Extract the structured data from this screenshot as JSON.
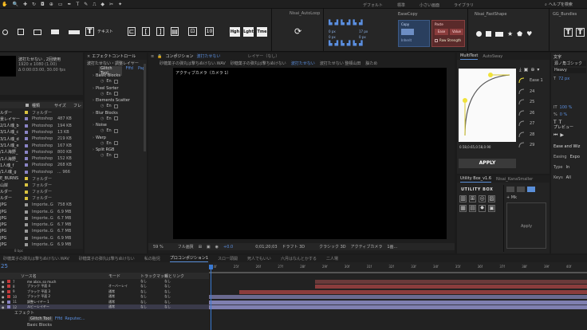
{
  "menubar": {
    "workspaces": [
      "デフォルト",
      "標準",
      "小さい画面",
      "ライブラリ"
    ],
    "search_label": "ヘルプを検索"
  },
  "toolbar": {
    "text_label": "テキスト",
    "panels": [
      "Nisai_AutoLoop",
      "EaseCopy",
      "Nisai_FastShape",
      "GG_Bundles"
    ],
    "ease_copy": {
      "copy": "Copy",
      "paste": "Paste",
      "ease": "Ease",
      "value": "Value",
      "raw_strength": "Raw Strength",
      "inherit": "Inherit"
    },
    "ease_values": [
      "0 px",
      "0 px",
      "17 px",
      "0 px"
    ]
  },
  "project_panel": {
    "comp_name": "波打たせない , 2回使用",
    "comp_info1": "1920 x 1080 (1.00)",
    "comp_info2": "Δ 0:00:03:00, 30.00 fps",
    "headers": {
      "name": "種類",
      "size": "サイズ",
      "frame": "フレ"
    },
    "items": [
      {
        "name": "ルダー",
        "type": "フォルダー",
        "size": "",
        "color": "#d9c33f"
      },
      {
        "name": "景レイヤー",
        "type": "Photoshop",
        "size": "487 KB",
        "color": "#8a84c6"
      },
      {
        "name": "2/1人魂_b",
        "type": "Photoshop",
        "size": "194 KB",
        "color": "#8a84c6"
      },
      {
        "name": "3/1人魂_c",
        "type": "Photoshop",
        "size": "13 KB",
        "color": "#8a84c6"
      },
      {
        "name": "3/1人魂_d",
        "type": "Photoshop",
        "size": "219 KB",
        "color": "#8a84c6"
      },
      {
        "name": "3/1人魂_e",
        "type": "Photoshop",
        "size": "167 KB",
        "color": "#8a84c6"
      },
      {
        "name": "/1人海野_",
        "type": "Photoshop",
        "size": "800 KB",
        "color": "#8a84c6"
      },
      {
        "name": "/1人海野_",
        "type": "Photoshop",
        "size": "152 KB",
        "color": "#8a84c6"
      },
      {
        "name": "1人魂_f",
        "type": "Photoshop",
        "size": "268 KB",
        "color": "#8a84c6"
      },
      {
        "name": "/1人魂_g",
        "type": "Photoshop",
        "size": "... 966",
        "color": "#8a84c6"
      },
      {
        "name": "E_BURNS",
        "type": "フォルダー",
        "size": "",
        "color": "#d9c33f"
      },
      {
        "name": "山岸",
        "type": "フォルダー",
        "size": "",
        "color": "#d9c33f"
      },
      {
        "name": "ルダー",
        "type": "フォルダー",
        "size": "",
        "color": "#d9c33f"
      },
      {
        "name": "ルダー",
        "type": "フォルダー",
        "size": "",
        "color": "#d9c33f"
      },
      {
        "name": "JPG",
        "type": "Importe..G",
        "size": "758 KB",
        "color": "#9a9a9a"
      },
      {
        "name": "JPG",
        "type": "Importe..G",
        "size": "6.9 MB",
        "color": "#9a9a9a"
      },
      {
        "name": "JPG",
        "type": "Importe..G",
        "size": "6.7 MB",
        "color": "#9a9a9a"
      },
      {
        "name": "JPG",
        "type": "Importe..G",
        "size": "6.7 MB",
        "color": "#9a9a9a"
      },
      {
        "name": "JPG",
        "type": "Importe..G",
        "size": "6.7 MB",
        "color": "#9a9a9a"
      },
      {
        "name": "JPG",
        "type": "Importe..G",
        "size": "6.9 MB",
        "color": "#9a9a9a"
      },
      {
        "name": "JPG",
        "type": "Importe..G",
        "size": "6.9 MB",
        "color": "#9a9a9a"
      }
    ],
    "footer": "8 bpc"
  },
  "effect_controls": {
    "title": "エフェクトコントロール",
    "subtitle": "波打たせない・調整レイヤー",
    "tabs": [
      "Glitch Tool",
      "Fffd",
      "Pap"
    ],
    "effects": [
      "Basic Blocks",
      "Pixel Sorter",
      "Elements Scatter",
      "Blur Blocks",
      "Noise",
      "Warp",
      "Split RGB"
    ],
    "en_label": "En"
  },
  "composition": {
    "panel_title": "コンポジション",
    "comp_tab": "波打たせない",
    "layer_tab": "レイヤー（なし）",
    "breadcrumbs": [
      "砂糖菓子の弾丸は撃ちぬけない.WAV",
      "砂糖菓子の弾丸は撃ちぬけない",
      "波打たせない",
      "波打たせない 整頓山田",
      "脳ため"
    ],
    "viewer_label": "アクティブカメラ（カメラ 1）",
    "footer": {
      "zoom": "59 %",
      "quality": "フル画質",
      "timecode": "0;01;20;03",
      "exposure": "+0.0",
      "view": "ドラフト 3D",
      "renderer": "クラシック 3D",
      "camera": "アクティブカメラ",
      "views": "1画..."
    }
  },
  "multitext": {
    "tabs": [
      "MultiText",
      "AutoSway"
    ],
    "curve_values": "0.58,0.65,0.58,0.90",
    "apply_label": "APPLY",
    "presets": [
      "Ease 1",
      "24",
      "25",
      "26",
      "27",
      "28",
      "29"
    ]
  },
  "utility_box": {
    "tabs": [
      "Utility Box_v1.6",
      "Nisai_KanaSmaller"
    ],
    "logo": "UTILITY BOX",
    "apply_label": "Apply",
    "mode_label": "Mk"
  },
  "character_panel": {
    "title": "文字",
    "font_family": "源ノ角ゴシック",
    "font_style": "Heavy",
    "size": "72 px",
    "tracking": "100 %",
    "scale": "0 %",
    "preview_title": "プレビュー",
    "ease_title": "Ease and Wiz",
    "ease_rows": [
      "Easing",
      "Type",
      "Keys"
    ],
    "ease_values": [
      "Expo",
      "In",
      "All"
    ]
  },
  "timeline": {
    "tabs": [
      "砂糖菓子の弾丸は撃ちぬけない.WAV",
      "砂糖菓子の弾丸は撃ちぬけない",
      "私の胎児",
      "プロコンポジション1",
      "スロー頭開",
      "死人でもいい",
      "六月はなんとかする",
      "二人場"
    ],
    "timecode": "25",
    "headers": {
      "source": "ソース名",
      "mode": "モード",
      "trkmat": "トラックマット",
      "parent": "親とリンク"
    },
    "layers": [
      {
        "num": "7",
        "name": "me abcv..so much",
        "mode": "",
        "trk": "なし",
        "parent": "なし",
        "color": "#c43b3b"
      },
      {
        "num": "8",
        "name": "ブラック 平面 4",
        "mode": "オーバーレイ",
        "trk": "なし",
        "parent": "なし",
        "color": "#c43b3b"
      },
      {
        "num": "9",
        "name": "ブラック 平面 3",
        "mode": "通常",
        "trk": "なし",
        "parent": "なし",
        "color": "#c43b3b"
      },
      {
        "num": "10",
        "name": "ブラック 平面 2",
        "mode": "通常",
        "trk": "なし",
        "parent": "なし",
        "color": "#c43b3b"
      },
      {
        "num": "11",
        "name": "調整レイヤー 1",
        "mode": "通常",
        "trk": "なし",
        "parent": "なし",
        "color": "#8a84c6"
      },
      {
        "num": "12",
        "name": "ルビーレイヤー",
        "mode": "通常",
        "trk": "なし",
        "parent": "なし",
        "color": "#8a84c6"
      }
    ],
    "effect_label": "エフェクト",
    "effect_tabs": [
      "Glitch Tool",
      "Fffd",
      "Reputec..."
    ],
    "effect_sub": "Basic Blocks",
    "ruler": [
      "24f",
      "25f",
      "26f",
      "27f",
      "28f",
      "29f",
      "30f",
      "31f",
      "32f",
      "33f",
      "34f",
      "35f",
      "36f",
      "37f",
      "38f",
      "39f",
      "40f"
    ]
  },
  "colors": {
    "accent": "#5a8fd9",
    "curve": "#f0e23a",
    "apply_bg": "#3a3a3a"
  }
}
